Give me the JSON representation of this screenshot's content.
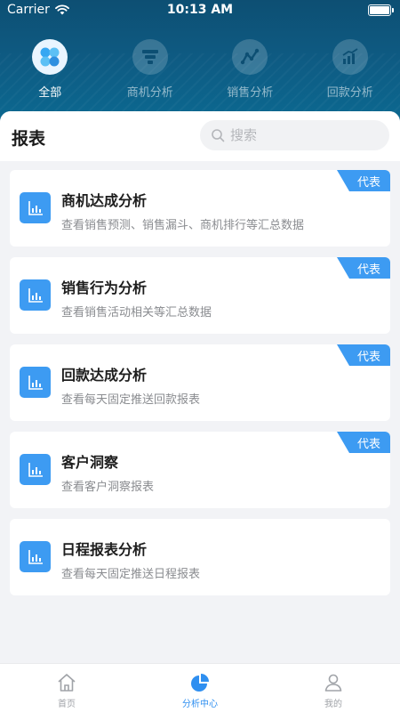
{
  "status_bar": {
    "carrier": "Carrier",
    "time": "10:13 AM",
    "battery_level": 1.0
  },
  "top_tabs": [
    {
      "label": "全部",
      "icon": "grid-dots-icon",
      "active": true
    },
    {
      "label": "商机分析",
      "icon": "funnel-icon",
      "active": false
    },
    {
      "label": "销售分析",
      "icon": "trend-line-icon",
      "active": false
    },
    {
      "label": "回款分析",
      "icon": "bar-growth-icon",
      "active": false
    }
  ],
  "page": {
    "title": "报表"
  },
  "search": {
    "placeholder": "搜索",
    "value": ""
  },
  "reports": [
    {
      "title": "商机达成分析",
      "desc": "查看销售预测、销售漏斗、商机排行等汇总数据",
      "badge": "代表"
    },
    {
      "title": "销售行为分析",
      "desc": "查看销售活动相关等汇总数据",
      "badge": "代表"
    },
    {
      "title": "回款达成分析",
      "desc": "查看每天固定推送回款报表",
      "badge": "代表"
    },
    {
      "title": "客户洞察",
      "desc": "查看客户洞察报表",
      "badge": "代表"
    },
    {
      "title": "日程报表分析",
      "desc": "查看每天固定推送日程报表",
      "badge": ""
    }
  ],
  "bottom_nav": [
    {
      "label": "首页",
      "icon": "home-icon",
      "active": false
    },
    {
      "label": "分析中心",
      "icon": "pie-chart-icon",
      "active": true
    },
    {
      "label": "我的",
      "icon": "user-icon",
      "active": false
    }
  ],
  "colors": {
    "header": "#0e5b83",
    "accent": "#3d9bf2",
    "active_nav": "#2f8ff0"
  }
}
